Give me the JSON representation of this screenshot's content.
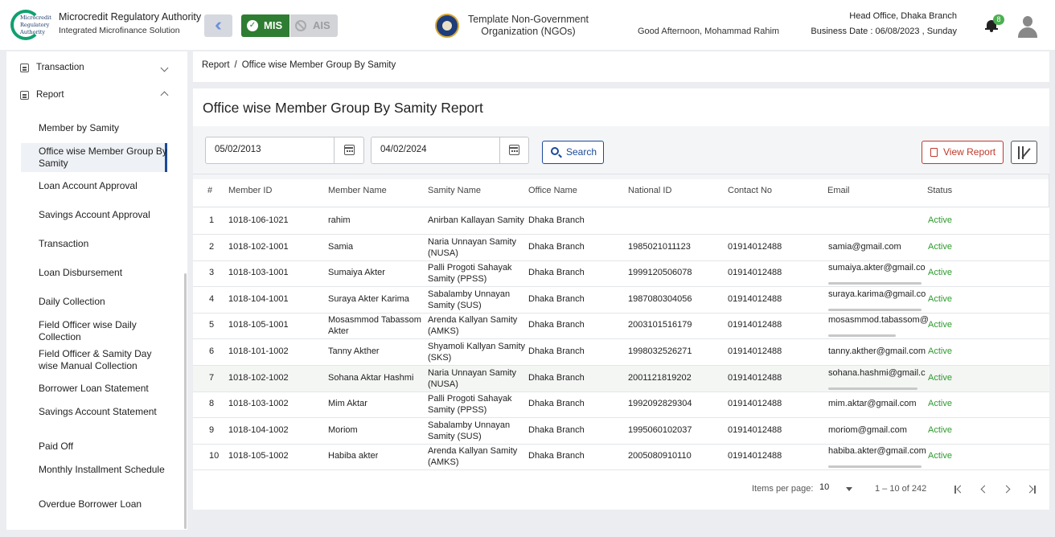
{
  "header": {
    "logo_text": "Microcredit Regulatory Authority",
    "org_title": "Microcredit Regulatory Authority",
    "org_subtitle": "Integrated Microfinance Solution",
    "mis_label": "MIS",
    "ais_label": "AIS",
    "ngo_name": "Template Non-Government Organization (NGOs)",
    "greeting": "Good Afternoon, Mohammad Rahim",
    "branch": "Head Office, Dhaka Branch",
    "business_date": "Business Date : 06/08/2023 , Sunday",
    "notification_count": "8"
  },
  "sidebar": {
    "top_items": [
      {
        "label": "Transaction",
        "expanded": false
      },
      {
        "label": "Report",
        "expanded": true
      }
    ],
    "items": [
      "Member by Samity",
      "Office wise Member Group By Samity",
      "Loan Account Approval",
      "Savings Account Approval",
      "Transaction",
      "Loan Disbursement",
      "Daily Collection",
      "Field Officer wise Daily Collection",
      "Field Officer & Samity Day wise Manual Collection",
      "Borrower Loan Statement",
      "Savings Account Statement",
      "Paid Off",
      "Monthly Installment Schedule",
      "Overdue Borrower Loan"
    ],
    "active_index": 1
  },
  "breadcrumb": {
    "root": "Report",
    "separator": "/",
    "current": "Office wise Member Group By Samity"
  },
  "page": {
    "title": "Office wise Member Group By Samity Report",
    "from_date": "05/02/2013",
    "to_date": "04/02/2024",
    "search_label": "Search",
    "view_report_label": "View Report"
  },
  "table": {
    "columns": [
      "#",
      "Member ID",
      "Member Name",
      "Samity Name",
      "Office Name",
      "National ID",
      "Contact No",
      "Email",
      "Status"
    ],
    "rows": [
      [
        "1",
        "1018-106-1021",
        "rahim",
        "Anirban Kallayan Samity",
        "Dhaka Branch",
        "",
        "",
        "",
        "Active"
      ],
      [
        "2",
        "1018-102-1001",
        "Samia",
        "Naria Unnayan Samity (NUSA)",
        "Dhaka Branch",
        "1985021011123",
        "01914012488",
        "samia@gmail.com",
        "Active"
      ],
      [
        "3",
        "1018-103-1001",
        "Sumaiya Akter",
        "Palli Progoti Sahayak Samity (PPSS)",
        "Dhaka Branch",
        "1999120506078",
        "01914012488",
        "sumaiya.akter@gmail.co",
        "Active"
      ],
      [
        "4",
        "1018-104-1001",
        "Suraya Akter Karima",
        "Sabalamby Unnayan Samity (SUS)",
        "Dhaka Branch",
        "1987080304056",
        "01914012488",
        "suraya.karima@gmail.co",
        "Active"
      ],
      [
        "5",
        "1018-105-1001",
        "Mosasmmod Tabassom Akter",
        "Arenda Kallyan Samity (AMKS)",
        "Dhaka Branch",
        "2003101516179",
        "01914012488",
        "mosasmmod.tabassom@",
        "Active"
      ],
      [
        "6",
        "1018-101-1002",
        "Tanny Akther",
        "Shyamoli Kallyan Samity (SKS)",
        "Dhaka Branch",
        "1998032526271",
        "01914012488",
        "tanny.akther@gmail.com",
        "Active"
      ],
      [
        "7",
        "1018-102-1002",
        "Sohana Aktar Hashmi",
        "Naria Unnayan Samity (NUSA)",
        "Dhaka Branch",
        "2001121819202",
        "01914012488",
        "sohana.hashmi@gmail.c",
        "Active"
      ],
      [
        "8",
        "1018-103-1002",
        "Mim Aktar",
        "Palli Progoti Sahayak Samity (PPSS)",
        "Dhaka Branch",
        "1992092829304",
        "01914012488",
        "mim.aktar@gmail.com",
        "Active"
      ],
      [
        "9",
        "1018-104-1002",
        "Moriom",
        "Sabalamby Unnayan Samity (SUS)",
        "Dhaka Branch",
        "1995060102037",
        "01914012488",
        "moriom@gmail.com",
        "Active"
      ],
      [
        "10",
        "1018-105-1002",
        "Habiba akter",
        "Arenda Kallyan Samity (AMKS)",
        "Dhaka Branch",
        "2005080910110",
        "01914012488",
        "habiba.akter@gmail.com",
        "Active"
      ]
    ],
    "highlighted_row": 7
  },
  "paginator": {
    "items_per_page_label": "Items per page:",
    "page_size": "10",
    "range": "1 – 10 of 242"
  },
  "colors": {
    "primary": "#1a4a9a",
    "mis_green": "#2e7d32",
    "status_active": "#2e9a2e",
    "report_red": "#c0392b"
  }
}
